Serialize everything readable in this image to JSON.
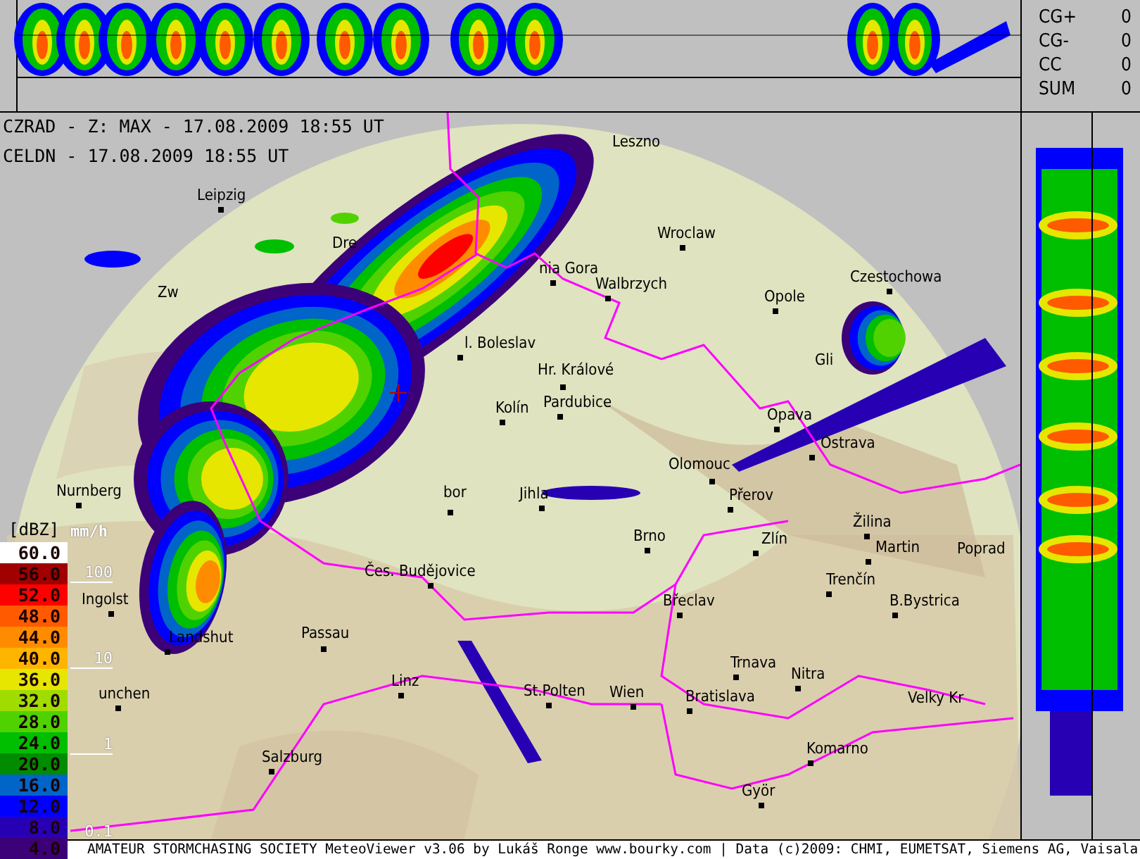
{
  "header": {
    "radar_line": "CZRAD - Z: MAX - 17.08.2009 18:55 UT",
    "lightning_line": "CELDN - 17.08.2009 18:55 UT"
  },
  "lightning_stats": [
    {
      "label": "CG+",
      "value": "0"
    },
    {
      "label": "CG-",
      "value": "0"
    },
    {
      "label": "CC",
      "value": "0"
    },
    {
      "label": "SUM",
      "value": "0"
    }
  ],
  "map": {
    "cities": [
      {
        "name": "Leszno"
      },
      {
        "name": "Leipzig"
      },
      {
        "name": "Wroclaw"
      },
      {
        "name": "Dre"
      },
      {
        "name": "nia Gora"
      },
      {
        "name": "Czestochowa"
      },
      {
        "name": "Walbrzych"
      },
      {
        "name": "Zw"
      },
      {
        "name": "Opole"
      },
      {
        "name": "l. Boleslav"
      },
      {
        "name": "Gli"
      },
      {
        "name": "Hr. Králové"
      },
      {
        "name": "Pardubice"
      },
      {
        "name": "Kolín"
      },
      {
        "name": "Opava"
      },
      {
        "name": "Ostrava"
      },
      {
        "name": "Olomouc"
      },
      {
        "name": "Nurnberg"
      },
      {
        "name": "bor"
      },
      {
        "name": "Jihla"
      },
      {
        "name": "Přerov"
      },
      {
        "name": "Žilina"
      },
      {
        "name": "Brno"
      },
      {
        "name": "Zlín"
      },
      {
        "name": "Martin"
      },
      {
        "name": "Poprad"
      },
      {
        "name": "Čes. Budějovice"
      },
      {
        "name": "Trenčín"
      },
      {
        "name": "Ingolst"
      },
      {
        "name": "Břeclav"
      },
      {
        "name": "B.Bystrica"
      },
      {
        "name": "Passau"
      },
      {
        "name": "Landshut"
      },
      {
        "name": "Trnava"
      },
      {
        "name": "Nitra"
      },
      {
        "name": "unchen"
      },
      {
        "name": "Linz"
      },
      {
        "name": "St.Polten"
      },
      {
        "name": "Wien"
      },
      {
        "name": "Bratislava"
      },
      {
        "name": "Velky Kr"
      },
      {
        "name": "Komarno"
      },
      {
        "name": "Salzburg"
      },
      {
        "name": "Györ"
      }
    ]
  },
  "legend": {
    "unit": "[dBZ]",
    "levels": [
      {
        "value": "60.0",
        "color": "#ffffff"
      },
      {
        "value": "56.0",
        "color": "#a00000"
      },
      {
        "value": "52.0",
        "color": "#ff0000"
      },
      {
        "value": "48.0",
        "color": "#ff5a00"
      },
      {
        "value": "44.0",
        "color": "#ff8c00"
      },
      {
        "value": "40.0",
        "color": "#ffb400"
      },
      {
        "value": "36.0",
        "color": "#e6e600"
      },
      {
        "value": "32.0",
        "color": "#a0dc00"
      },
      {
        "value": "28.0",
        "color": "#50d200"
      },
      {
        "value": "24.0",
        "color": "#00be00"
      },
      {
        "value": "20.0",
        "color": "#008c00"
      },
      {
        "value": "16.0",
        "color": "#0064c8"
      },
      {
        "value": "12.0",
        "color": "#0000ff"
      },
      {
        "value": "8.0",
        "color": "#2800b4"
      },
      {
        "value": "4.0",
        "color": "#3c0078"
      }
    ],
    "rain_unit": "mm/h",
    "rain_marks": [
      "100",
      "10",
      "1",
      "0.1"
    ]
  },
  "footer": "AMATEUR STORMCHASING SOCIETY MeteoViewer v3.06 by Lukáš Ronge www.bourky.com | Data (c)2009: CHMI, EUMETSAT, Siemens AG, Vaisala"
}
